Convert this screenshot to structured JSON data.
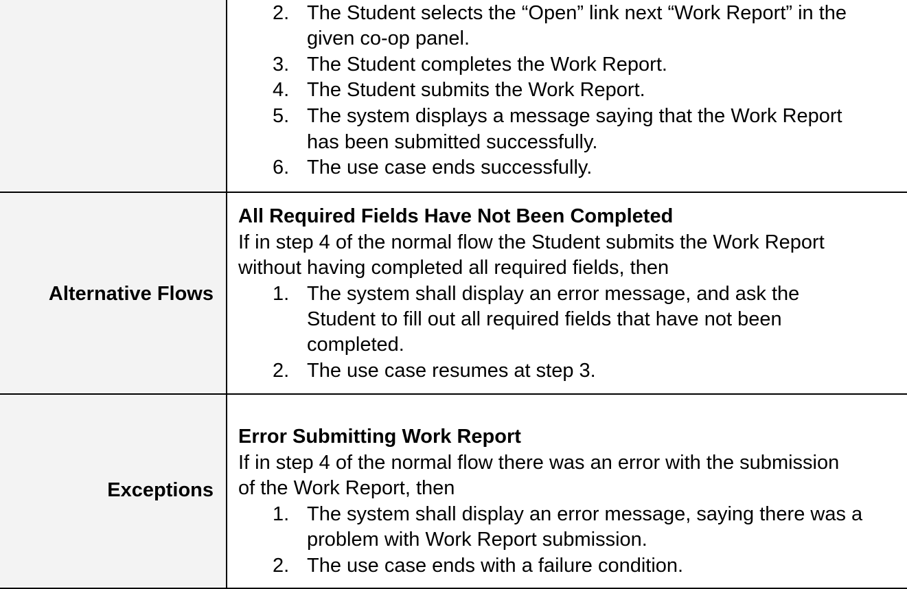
{
  "normal_flow": {
    "label": "",
    "steps": [
      {
        "num": "2.",
        "lines": [
          "The Student selects the “Open” link next “Work Report” in the",
          "given co-op panel."
        ]
      },
      {
        "num": "3.",
        "lines": [
          "The Student completes the Work Report."
        ]
      },
      {
        "num": "4.",
        "lines": [
          "The Student submits the Work Report."
        ]
      },
      {
        "num": "5.",
        "lines": [
          "The system displays a message saying that the Work Report",
          "has been submitted successfully."
        ]
      },
      {
        "num": "6.",
        "lines": [
          "The use case ends successfully."
        ]
      }
    ]
  },
  "alternative_flows": {
    "label": "Alternative Flows",
    "heading": "All Required Fields Have Not Been Completed",
    "intro_lines": [
      "If in step 4 of the normal flow the Student submits the Work Report",
      "without having completed all required fields, then"
    ],
    "steps": [
      {
        "num": "1.",
        "lines": [
          "The system shall display an error message, and ask the",
          "Student to fill out all required fields that have not been",
          "completed."
        ]
      },
      {
        "num": "2.",
        "lines": [
          "The use case resumes at step 3."
        ]
      }
    ]
  },
  "exceptions": {
    "label": "Exceptions",
    "heading": "Error Submitting Work Report",
    "intro_lines": [
      "If in step 4 of the normal flow there was an error with the submission",
      "of the Work Report, then"
    ],
    "steps": [
      {
        "num": "1.",
        "lines": [
          "The system shall display an error message, saying there was a",
          "problem with Work Report submission."
        ]
      },
      {
        "num": "2.",
        "lines": [
          "The use case ends with a failure condition."
        ]
      }
    ]
  }
}
